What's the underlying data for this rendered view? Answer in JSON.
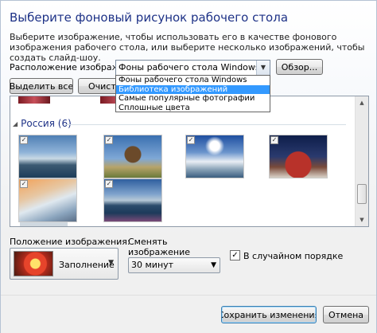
{
  "title": "Выберите фоновый рисунок рабочего стола",
  "description": "Выберите изображение, чтобы использовать его в качестве фонового изображения рабочего стола, или выберите несколько изображений, чтобы создать слайд-шоу.",
  "location": {
    "label": "Расположение изображения:",
    "selected": "Фоны рабочего стола Windows",
    "browse_label": "Обзор...",
    "options": [
      "Фоны рабочего стола Windows",
      "Библиотека изображений",
      "Самые популярные фотографии",
      "Сплошные цвета"
    ],
    "highlighted_index": 1
  },
  "select_all_label": "Выделить все",
  "clear_all_label": "Очистить все",
  "gallery": {
    "group_name": "Россия (6)",
    "thumbnails_checked": [
      true,
      true,
      true,
      true,
      true,
      true
    ]
  },
  "position": {
    "label": "Положение изображения:",
    "value": "Заполнение"
  },
  "change": {
    "label": "Сменять изображение каждые:",
    "value": "30 минут"
  },
  "random": {
    "label": "В случайном порядке",
    "checked": true
  },
  "footer": {
    "save_label": "Сохранить изменения",
    "cancel_label": "Отмена"
  },
  "icons": {
    "dropdown": "chevron-down-icon",
    "collapse": "triangle-collapse-icon",
    "checkbox": "checkmark-icon"
  }
}
